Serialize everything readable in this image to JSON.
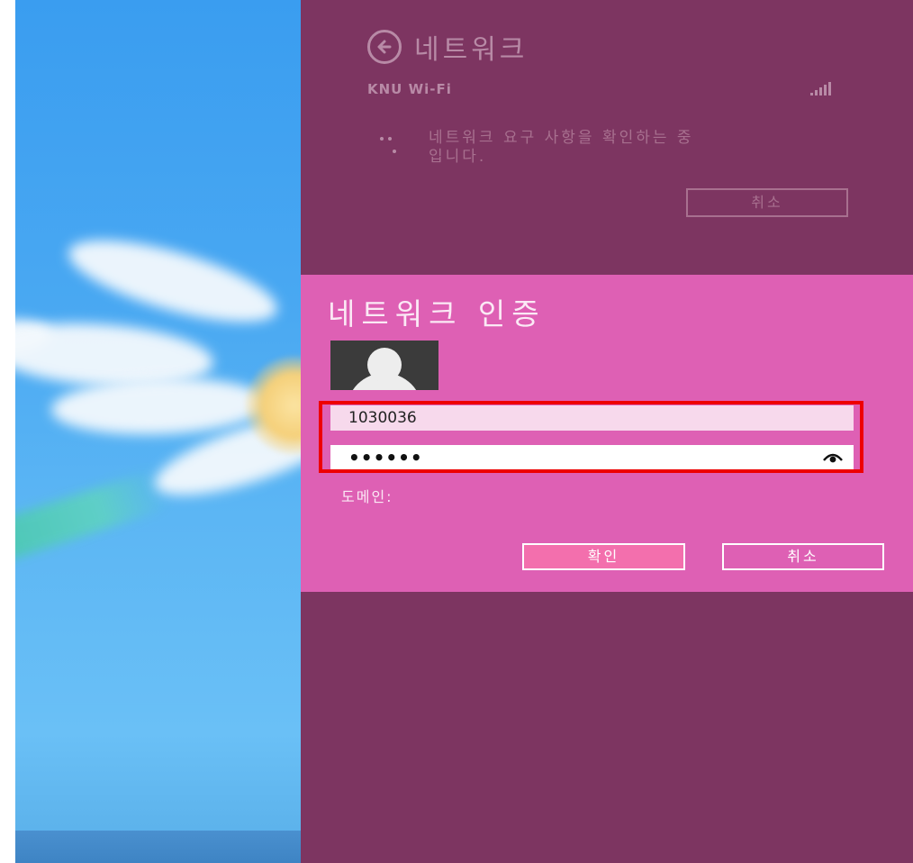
{
  "network_panel": {
    "title": "네트워크",
    "network_name": "KNU Wi-Fi",
    "status": "네트워크 요구 사항을 확인하는 중입니다.",
    "cancel_label": "취소"
  },
  "auth_dialog": {
    "title": "네트워크 인증",
    "username_value": "1030036",
    "password_mask": "••••••",
    "domain_label": "도메인:",
    "ok_label": "확인",
    "cancel_label": "취소"
  },
  "colors": {
    "panel_bg": "#7d3561",
    "dialog_bg": "#de60b4",
    "highlight": "#ee0000",
    "accent_button": "#f36fad"
  },
  "icons": {
    "back": "back-arrow-icon",
    "signal": "wifi-signal-icon",
    "avatar": "user-avatar-icon",
    "reveal": "password-reveal-icon"
  }
}
